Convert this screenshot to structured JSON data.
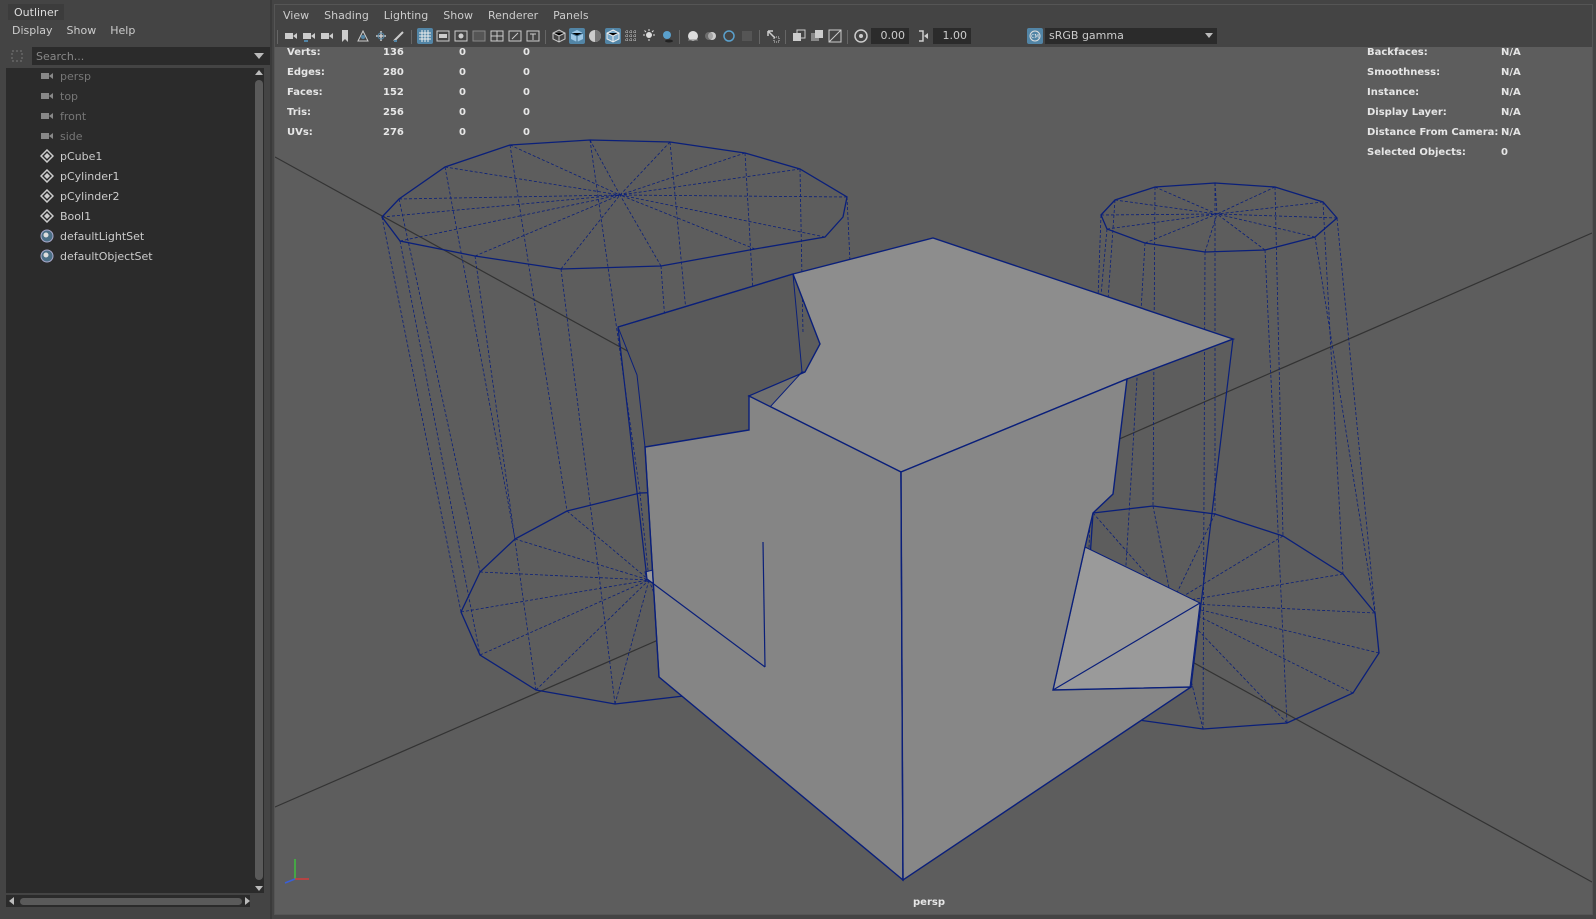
{
  "outliner": {
    "title": "Outliner",
    "menu": [
      "Display",
      "Show",
      "Help"
    ],
    "search_placeholder": "Search...",
    "items": [
      {
        "label": "persp",
        "kind": "camera",
        "icon": "camera-icon"
      },
      {
        "label": "top",
        "kind": "camera",
        "icon": "camera-icon"
      },
      {
        "label": "front",
        "kind": "camera",
        "icon": "camera-icon"
      },
      {
        "label": "side",
        "kind": "camera",
        "icon": "camera-icon"
      },
      {
        "label": "pCube1",
        "kind": "transform",
        "icon": "transform-icon"
      },
      {
        "label": "pCylinder1",
        "kind": "transform",
        "icon": "transform-icon"
      },
      {
        "label": "pCylinder2",
        "kind": "transform",
        "icon": "transform-icon"
      },
      {
        "label": "Bool1",
        "kind": "transform",
        "icon": "transform-icon"
      },
      {
        "label": "defaultLightSet",
        "kind": "set",
        "icon": "set-icon"
      },
      {
        "label": "defaultObjectSet",
        "kind": "set",
        "icon": "set-icon"
      }
    ]
  },
  "viewport": {
    "menu": [
      "View",
      "Shading",
      "Lighting",
      "Show",
      "Renderer",
      "Panels"
    ],
    "exposure": "0.00",
    "gamma": "1.00",
    "color_space": "sRGB gamma",
    "camera_label": "persp",
    "hud_left": [
      {
        "label": "Verts:",
        "v1": "136",
        "v2": "0",
        "v3": "0"
      },
      {
        "label": "Edges:",
        "v1": "280",
        "v2": "0",
        "v3": "0"
      },
      {
        "label": "Faces:",
        "v1": "152",
        "v2": "0",
        "v3": "0"
      },
      {
        "label": "Tris:",
        "v1": "256",
        "v2": "0",
        "v3": "0"
      },
      {
        "label": "UVs:",
        "v1": "276",
        "v2": "0",
        "v3": "0"
      }
    ],
    "hud_right": [
      {
        "label": "Backfaces:",
        "value": "N/A"
      },
      {
        "label": "Smoothness:",
        "value": "N/A"
      },
      {
        "label": "Instance:",
        "value": "N/A"
      },
      {
        "label": "Display Layer:",
        "value": "N/A"
      },
      {
        "label": "Distance From Camera:",
        "value": "N/A"
      },
      {
        "label": "Selected Objects:",
        "value": "0"
      }
    ],
    "toolbar_icons": [
      "select-camera-icon",
      "camera-attributes-icon",
      "bookmark-icon",
      "image-plane-icon",
      "two-d-pan-icon",
      "grease-pencil-icon",
      "grid-icon",
      "film-gate-icon",
      "resolution-gate-icon",
      "gate-mask-icon",
      "field-chart-icon",
      "safe-action-icon",
      "safe-title-icon",
      "wireframe-icon",
      "smooth-shade-icon",
      "textured-icon",
      "wireframe-on-shaded-icon",
      "xray-icon",
      "use-lights-icon",
      "shadows-icon",
      "screen-space-ao-icon",
      "motion-blur-icon",
      "anti-alias-icon",
      "depth-of-field-icon",
      "isolate-select-icon",
      "xray-joints-icon",
      "backface-culling-icon",
      "exposure-icon",
      "gamma-icon",
      "color-management-icon"
    ],
    "colors": {
      "wire": "#0a1f7a",
      "bg": "#5d5d5d",
      "cube_top": "#8c8c8c",
      "cube_front": "#858585",
      "cube_right": "#878787",
      "grid": "#333333",
      "hud_text": "#e6e6e6",
      "active": "#5285a6"
    }
  }
}
